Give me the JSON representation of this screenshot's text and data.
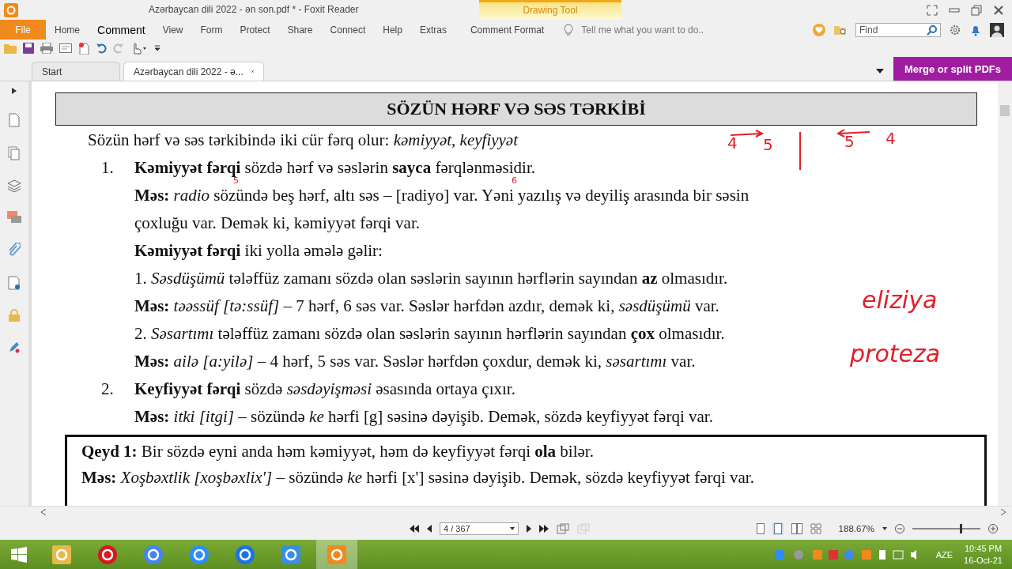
{
  "window": {
    "title": "Azərbaycan dili 2022 - ən son.pdf * - Foxit Reader"
  },
  "contextual_tab": {
    "label": "Drawing Tool"
  },
  "menu": [
    {
      "label": "File",
      "kind": "file"
    },
    {
      "label": "Home",
      "selected": false,
      "kind": "tab"
    },
    {
      "label": "Comment",
      "selected": true,
      "kind": "tab"
    },
    {
      "label": "View",
      "selected": false,
      "kind": "tab"
    },
    {
      "label": "Form",
      "selected": false,
      "kind": "tab"
    },
    {
      "label": "Protect",
      "selected": false,
      "kind": "tab"
    },
    {
      "label": "Share",
      "selected": false,
      "kind": "tab"
    },
    {
      "label": "Connect",
      "selected": false,
      "kind": "tab"
    },
    {
      "label": "Help",
      "selected": false,
      "kind": "tab"
    },
    {
      "label": "Extras",
      "selected": false,
      "kind": "tab"
    },
    {
      "label": "Comment Format",
      "selected": false,
      "kind": "tab"
    }
  ],
  "tell_me": {
    "placeholder": "Tell me what you want to do.."
  },
  "find": {
    "placeholder": "Find"
  },
  "promo_button": {
    "label": "Merge or split PDFs"
  },
  "doc_tabs": [
    {
      "label": "Start",
      "selected": false,
      "closable": false
    },
    {
      "label": "Azərbaycan dili 2022 - ə...",
      "selected": true,
      "closable": true
    }
  ],
  "document": {
    "title": "SÖZÜN HƏRF VƏ SƏS TƏRKİBİ",
    "lines": [
      {
        "kind": "lead",
        "text": "Sözün hərf və səs tərkibində iki cür fərq olur: *kəmiyyət, keyfiyyət*"
      },
      {
        "kind": "numbered",
        "number": "1.",
        "text": "**Kəmiyyət fərqi** sözdə hərf və səslərin **sayca** fərqlənməsidir."
      },
      {
        "kind": "line",
        "text": "**Məs:** *radio* sözündə beş hərf, altı səs – [radiyo] var. Yəni yazılış və deyiliş arasında bir səsin"
      },
      {
        "kind": "line",
        "text": "çoxluğu var. Demək ki, kəmiyyət fərqi var."
      },
      {
        "kind": "line",
        "text": "**Kəmiyyət fərqi** iki yolla əmələ gəlir:"
      },
      {
        "kind": "line",
        "text": "1. *Səsdüşümü* tələffüz zamanı sözdə olan səslərin sayının hərflərin sayından **az** olmasıdır."
      },
      {
        "kind": "line",
        "text": "**Məs:** *təəssüf [tə:ssüf]* – 7 hərf, 6 səs var. Səslər hərfdən azdır, demək ki, *səsdüşümü* var."
      },
      {
        "kind": "line",
        "text": "2. *Səsartımı* tələffüz zamanı sözdə olan səslərin sayının hərflərin sayından **çox** olmasıdır."
      },
      {
        "kind": "line",
        "text": "**Məs:** *ailə [a:yilə]* – 4 hərf, 5 səs var. Səslər hərfdən çoxdur, demək ki, *səsartımı* var."
      },
      {
        "kind": "numbered",
        "number": "2.",
        "text": "**Keyfiyyət fərqi** sözdə *səsdəyişməsi* əsasında ortaya çıxır."
      },
      {
        "kind": "line",
        "text": "**Məs:** *itki [itgi]* – sözündə *ke* hərfi [g] səsinə dəyişib. Demək, sözdə keyfiyyət fərqi var."
      }
    ],
    "note": [
      "**Qeyd 1:** Bir sözdə eyni anda həm kəmiyyət, həm də keyfiyyət fərqi **ola** bilər.",
      "**Məs:** *Xoşbəxtlik [xoşbəxlix']* – sözündə *ke* hərfi [x'] səsinə dəyişib. Demək, sözdə keyfiyyət fərqi var."
    ]
  },
  "ink_notes": [
    "5",
    "6",
    "4",
    "5",
    "5",
    "4",
    "eliziya",
    "proteza"
  ],
  "status_bar": {
    "page": "4 / 367",
    "zoom": "188.67%",
    "zoom_slider": {
      "level": 0.72
    }
  },
  "taskbar": {
    "apps": [
      {
        "selected": false
      },
      {
        "selected": false
      },
      {
        "selected": false
      },
      {
        "selected": false
      },
      {
        "selected": false
      },
      {
        "selected": false
      },
      {
        "selected": true
      }
    ],
    "language": "AZE",
    "time": "10:45 PM",
    "date": "16-Oct-21"
  }
}
